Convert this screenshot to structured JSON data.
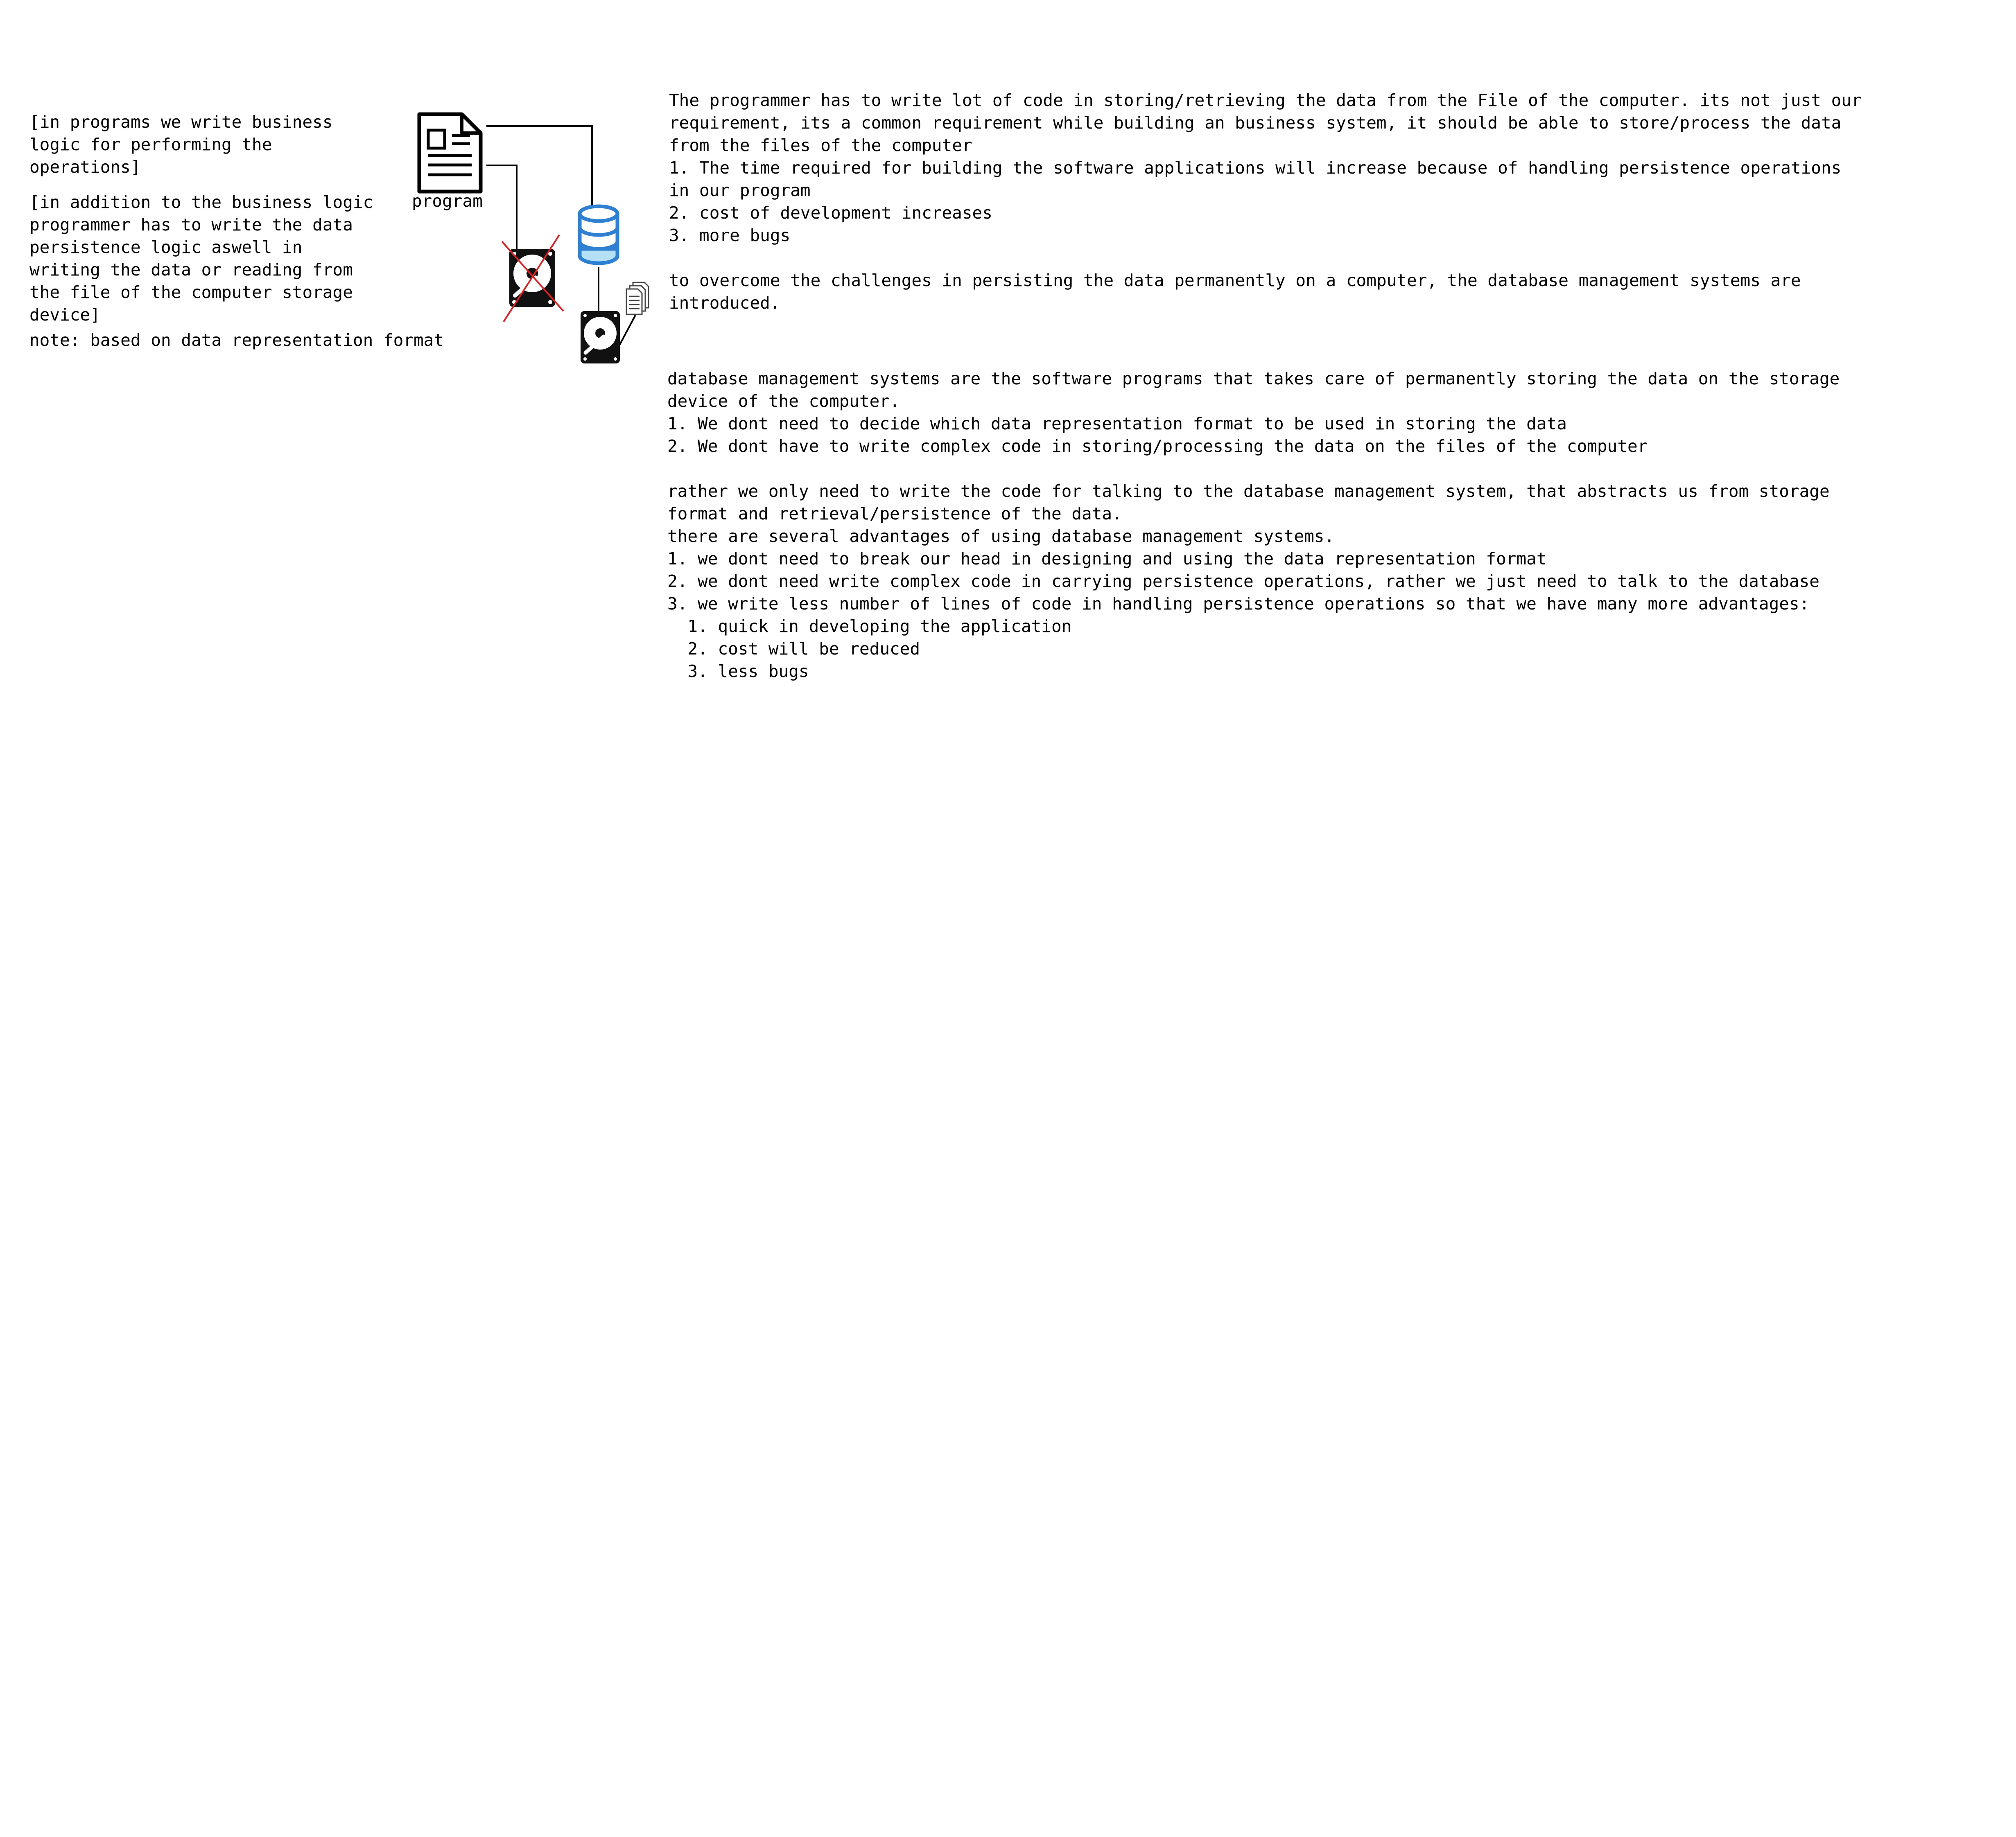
{
  "left_notes": {
    "business_logic": "[in programs we write business\nlogic for performing the\noperations]",
    "persistence_logic": "[in addition to the business logic\nprogrammer has to write the data\npersistence logic aswell in\nwriting the data or reading from\nthe file of the computer storage\ndevice]",
    "format_note": "note: based on data representation format"
  },
  "diagram": {
    "program_label": "program",
    "icons": [
      "document-icon",
      "hard-drive-icon",
      "database-icon",
      "files-icon"
    ],
    "colors": {
      "database": "#2f80d3",
      "database_fill": "#b5e0f5",
      "cross": "#e02020",
      "connector": "#000000"
    }
  },
  "right_block_1": "The programmer has to write lot of code in storing/retrieving the data from the File of the computer. its not just our\nrequirement, its a common requirement while building an business system, it should be able to store/process the data\nfrom the files of the computer\n1. The time required for building the software applications will increase because of handling persistence operations\nin our program\n2. cost of development increases\n3. more bugs\n\nto overcome the challenges in persisting the data permanently on a computer, the database management systems are\nintroduced.",
  "right_block_2": "database management systems are the software programs that takes care of permanently storing the data on the storage\ndevice of the computer.\n1. We dont need to decide which data representation format to be used in storing the data\n2. We dont have to write complex code in storing/processing the data on the files of the computer\n\nrather we only need to write the code for talking to the database management system, that abstracts us from storage\nformat and retrieval/persistence of the data.\nthere are several advantages of using database management systems.\n1. we dont need to break our head in designing and using the data representation format\n2. we dont need write complex code in carrying persistence operations, rather we just need to talk to the database\n3. we write less number of lines of code in handling persistence operations so that we have many more advantages:\n  1. quick in developing the application\n  2. cost will be reduced\n  3. less bugs"
}
